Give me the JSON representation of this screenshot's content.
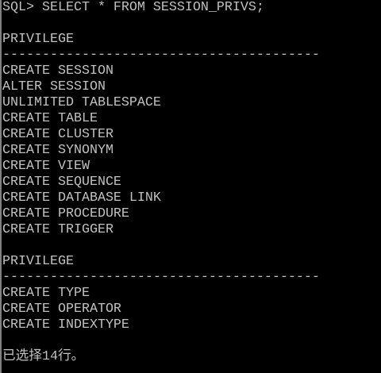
{
  "command": "SQL> SELECT * FROM SESSION_PRIVS;",
  "blocks": [
    {
      "header": "PRIVILEGE",
      "separator": "----------------------------------------",
      "rows": [
        "CREATE SESSION",
        "ALTER SESSION",
        "UNLIMITED TABLESPACE",
        "CREATE TABLE",
        "CREATE CLUSTER",
        "CREATE SYNONYM",
        "CREATE VIEW",
        "CREATE SEQUENCE",
        "CREATE DATABASE LINK",
        "CREATE PROCEDURE",
        "CREATE TRIGGER"
      ]
    },
    {
      "header": "PRIVILEGE",
      "separator": "----------------------------------------",
      "rows": [
        "CREATE TYPE",
        "CREATE OPERATOR",
        "CREATE INDEXTYPE"
      ]
    }
  ],
  "footer": "已选择14行。"
}
